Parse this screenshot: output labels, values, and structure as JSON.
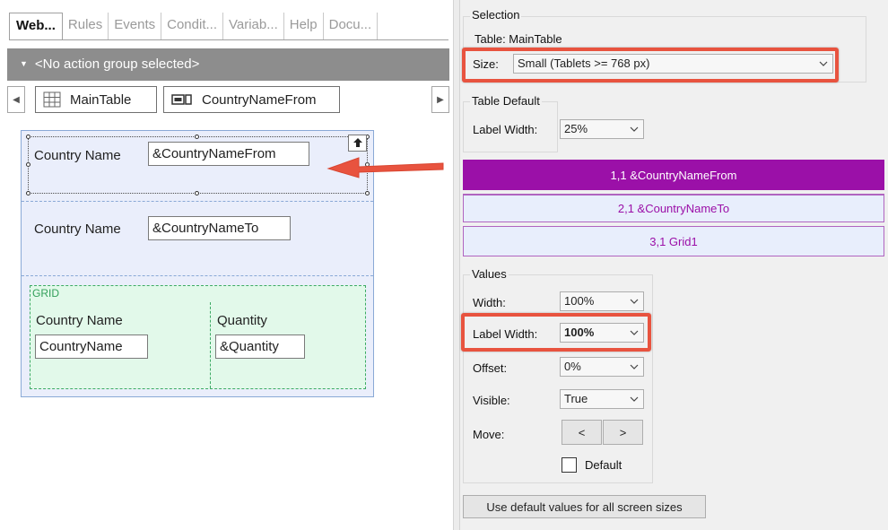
{
  "tabs": [
    {
      "label": "Web..."
    },
    {
      "label": "Rules"
    },
    {
      "label": "Events"
    },
    {
      "label": "Condit..."
    },
    {
      "label": "Variab..."
    },
    {
      "label": "Help"
    },
    {
      "label": "Docu..."
    }
  ],
  "action_bar": {
    "icon": "triangle-down-icon",
    "label": "<No action group selected>"
  },
  "breadcrumb": [
    {
      "label": "MainTable",
      "icon": "table-grid-icon"
    },
    {
      "label": "CountryNameFrom",
      "icon": "textbox-icon"
    }
  ],
  "form": {
    "row1": {
      "label": "Country Name",
      "value": "&CountryNameFrom"
    },
    "row2": {
      "label": "Country Name",
      "value": "&CountryNameTo"
    },
    "grid": {
      "title": "GRID",
      "col1": {
        "header": "Country Name",
        "value": "CountryName"
      },
      "col2": {
        "header": "Quantity",
        "value": "&Quantity"
      }
    }
  },
  "selection": {
    "title": "Selection",
    "table": "Table: MainTable",
    "size_label": "Size:",
    "size_value": "Small (Tablets >= 768 px)"
  },
  "table_default": {
    "title": "Table Default",
    "label_width_label": "Label Width:",
    "label_width_value": "25%"
  },
  "cells": [
    {
      "label": "1,1 &CountryNameFrom"
    },
    {
      "label": "2,1 &CountryNameTo"
    },
    {
      "label": "3,1 Grid1"
    }
  ],
  "values": {
    "title": "Values",
    "width_label": "Width:",
    "width_value": "100%",
    "label_width_label": "Label Width:",
    "label_width_value": "100%",
    "offset_label": "Offset:",
    "offset_value": "0%",
    "visible_label": "Visible:",
    "visible_value": "True",
    "move_label": "Move:",
    "move_left": "<",
    "move_right": ">",
    "default_label": "Default",
    "default_checked": false
  },
  "use_default_button": "Use default values for all screen sizes",
  "colors": {
    "accent_red": "#e8533f",
    "selected_cell": "#9b10a8",
    "cell_bg": "#e8eefc",
    "grid_bg": "#e2f9ea"
  }
}
